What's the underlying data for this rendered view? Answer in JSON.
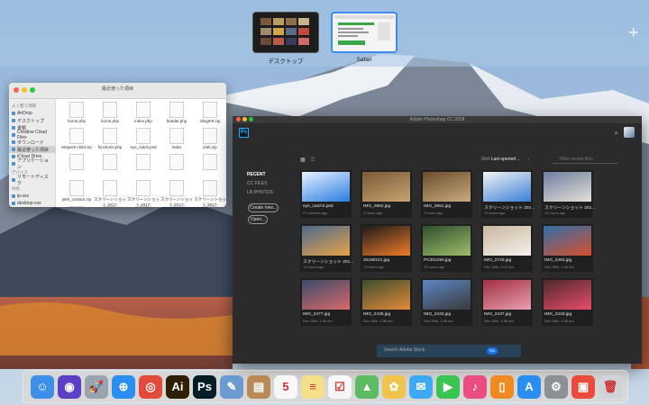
{
  "spaces": {
    "items": [
      {
        "label": "デスクトップ"
      },
      {
        "label": "Safari"
      }
    ],
    "add_label": "+"
  },
  "finder": {
    "title": "最近使った項目",
    "sidebar_favorites_head": "よく使う項目",
    "sidebar_devices_head": "デバイス",
    "sidebar_tags_head": "共有",
    "favorites": [
      "AirDrop",
      "デスクトップ",
      "書類",
      "Creative Cloud Files",
      "ダウンロード",
      "最近使った項目",
      "iCloud Drive",
      "アプリケーション"
    ],
    "devices": [
      "リモートディスク"
    ],
    "shared": [
      "ip-xxx",
      "desktop-xxx",
      "nasne-xxx"
    ],
    "files": [
      "home.php",
      "home.php",
      "index.php",
      "header.php",
      "slinger8.zip",
      "slinger8-child.zip",
      "functions.php",
      "eye_catch.psd",
      "index",
      "jstrk.zip",
      "",
      "",
      "",
      "",
      "",
      "jstrk_custom.zip",
      "スクリーンショット 2017-12...10.40.27",
      "スクリーンショット 2017-12...10.40.22",
      "スクリーンショット 2017-12...10.39.05",
      "スクリーンショット 2017-12...10.38.32",
      "",
      "スクリーンショット 2017-12...10.39.02",
      "スクリーンショット 2017-12...",
      "スクリーンショット 2017-12...",
      "スクリーンショット 2017-12..."
    ]
  },
  "photoshop": {
    "title": "Adobe Photoshop CC 2018",
    "logo": "Ps",
    "nav": [
      {
        "label": "RECENT",
        "active": true
      },
      {
        "label": "CC FILES",
        "active": false
      },
      {
        "label": "LR PHOTOS",
        "active": false
      }
    ],
    "create_label": "Create new...",
    "open_label": "Open...",
    "sort_label": "Sort",
    "sort_value": "Last opened",
    "filter_placeholder": "Filter recent files",
    "stock_placeholder": "Search Adobe Stock",
    "stock_go": "Go",
    "files": [
      {
        "name": "eye_catch2.psd",
        "date": "27 minutes ago"
      },
      {
        "name": "IMG_2852.jpg",
        "date": "4 hours ago"
      },
      {
        "name": "IMG_2851.jpg",
        "date": "4 hours ago"
      },
      {
        "name": "スクリーンショット 201...",
        "date": "13 hours ago"
      },
      {
        "name": "スクリーンショット 201...",
        "date": "13 hours ago"
      },
      {
        "name": "スクリーンショット 201...",
        "date": "13 hours ago"
      },
      {
        "name": "20180101.jpg",
        "date": "13 hours ago"
      },
      {
        "name": "PC301294.jpg",
        "date": "13 hours ago"
      },
      {
        "name": "IMG_2720.jpg",
        "date": "Dec 28th, 2:14 am"
      },
      {
        "name": "IMG_2463.jpg",
        "date": "Dec 28th, 1:56 am"
      },
      {
        "name": "IMG_2477.jpg",
        "date": "Dec 28th, 1:56 am"
      },
      {
        "name": "IMG_2436.jpg",
        "date": "Dec 28th, 1:56 am"
      },
      {
        "name": "IMG_2433.jpg",
        "date": "Dec 28th, 1:56 am"
      },
      {
        "name": "IMG_2437.jpg",
        "date": "Dec 28th, 1:56 am"
      },
      {
        "name": "IMG_2418.jpg",
        "date": "Dec 28th, 1:56 am"
      }
    ]
  },
  "dock": {
    "apps": [
      {
        "name": "Finder",
        "glyph": "☺",
        "color": "#3d8fe8"
      },
      {
        "name": "Siri",
        "glyph": "◉",
        "color": "#5b3fc4"
      },
      {
        "name": "Launchpad",
        "glyph": "🚀",
        "color": "#9aa4b0"
      },
      {
        "name": "Safari",
        "glyph": "⊕",
        "color": "#2a8ef0"
      },
      {
        "name": "Chrome",
        "glyph": "◎",
        "color": "#e24a3b"
      },
      {
        "name": "Illustrator",
        "glyph": "Ai",
        "color": "#2d1f00"
      },
      {
        "name": "Photoshop",
        "glyph": "Ps",
        "color": "#001d26"
      },
      {
        "name": "Preview",
        "glyph": "✎",
        "color": "#6c9bd1"
      },
      {
        "name": "Contacts",
        "glyph": "▤",
        "color": "#b98a55"
      },
      {
        "name": "Calendar",
        "glyph": "5",
        "color": "#f7f7f7"
      },
      {
        "name": "Notes",
        "glyph": "≡",
        "color": "#f4e08a"
      },
      {
        "name": "Reminders",
        "glyph": "☑",
        "color": "#f7f7f7"
      },
      {
        "name": "Maps",
        "glyph": "▲",
        "color": "#5dbb63"
      },
      {
        "name": "Photos",
        "glyph": "✿",
        "color": "#f0c44b"
      },
      {
        "name": "Messages",
        "glyph": "✉",
        "color": "#3fa9f5"
      },
      {
        "name": "FaceTime",
        "glyph": "▶",
        "color": "#3cc451"
      },
      {
        "name": "iTunes",
        "glyph": "♪",
        "color": "#e94d84"
      },
      {
        "name": "iBooks",
        "glyph": "▯",
        "color": "#f08b24"
      },
      {
        "name": "App Store",
        "glyph": "A",
        "color": "#2a8ef0"
      },
      {
        "name": "System Preferences",
        "glyph": "⚙",
        "color": "#8b9096"
      },
      {
        "name": "Downloads",
        "glyph": "▣",
        "color": "#e94c3d"
      },
      {
        "name": "Trash",
        "glyph": "🗑",
        "color": "#cfd4d8"
      }
    ]
  }
}
